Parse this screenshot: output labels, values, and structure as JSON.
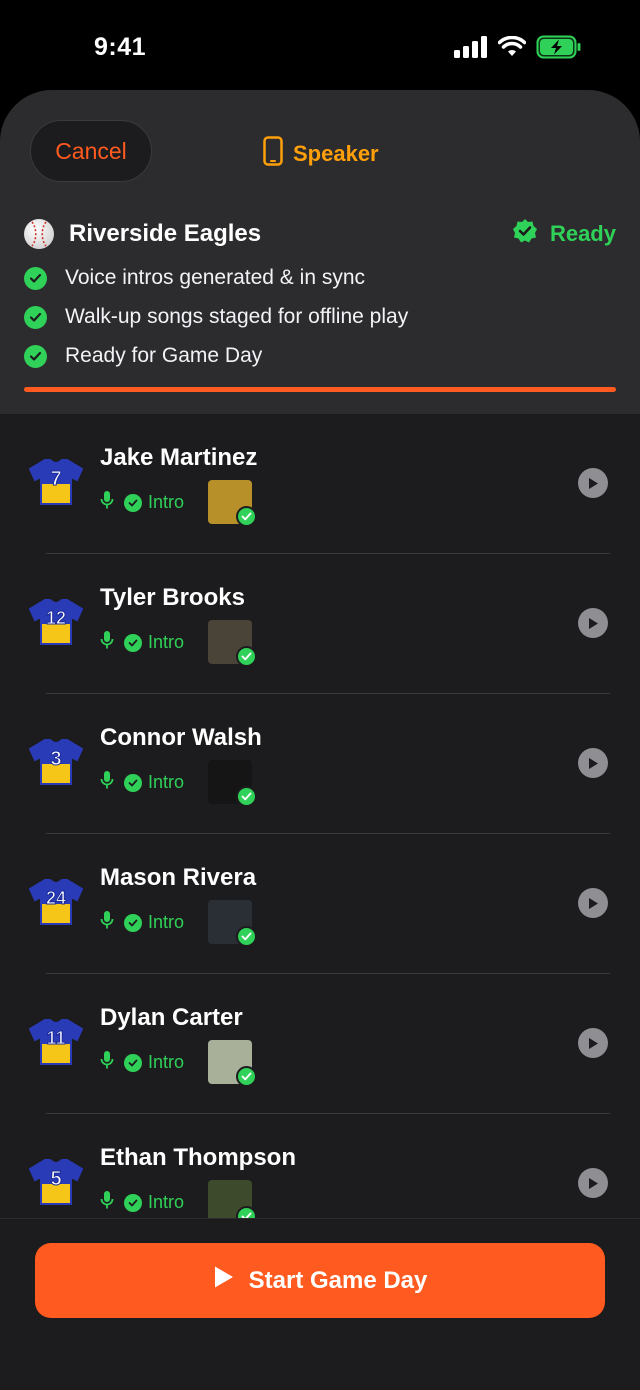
{
  "status_bar": {
    "time": "9:41"
  },
  "header": {
    "cancel_label": "Cancel",
    "speaker_label": "Speaker",
    "team_name": "Riverside Eagles",
    "ready_label": "Ready",
    "checklist": [
      "Voice intros generated & in sync",
      "Walk-up songs staged for offline play",
      "Ready for Game Day"
    ],
    "progress_fraction": 1.0
  },
  "players": [
    {
      "name": "Jake Martinez",
      "number": "7",
      "intro_label": "Intro",
      "album_color": "#b8902a"
    },
    {
      "name": "Tyler Brooks",
      "number": "12",
      "intro_label": "Intro",
      "album_color": "#4a4438"
    },
    {
      "name": "Connor Walsh",
      "number": "3",
      "intro_label": "Intro",
      "album_color": "#151515"
    },
    {
      "name": "Mason Rivera",
      "number": "24",
      "intro_label": "Intro",
      "album_color": "#2a2e35"
    },
    {
      "name": "Dylan Carter",
      "number": "11",
      "intro_label": "Intro",
      "album_color": "#a8b09a"
    },
    {
      "name": "Ethan Thompson",
      "number": "5",
      "intro_label": "Intro",
      "album_color": "#3e4a2c"
    }
  ],
  "footer": {
    "start_label": "Start Game Day"
  },
  "colors": {
    "accent": "#ff5a1f",
    "success": "#30d158",
    "speaker": "#ff9f0a",
    "jersey_body": "#f5c518",
    "jersey_trim": "#2a3bb8"
  }
}
